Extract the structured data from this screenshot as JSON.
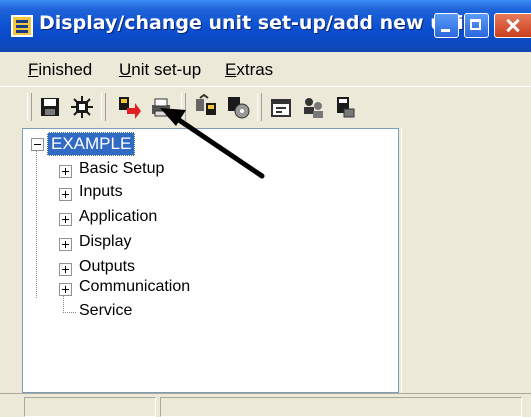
{
  "window": {
    "title": "Display/change unit set-up/add new unit"
  },
  "menu": {
    "items": [
      {
        "label": "Finished"
      },
      {
        "label": "Unit set-up"
      },
      {
        "label": "Extras"
      }
    ]
  },
  "toolbar": {
    "icons": [
      "save-icon",
      "settings-icon",
      "download-icon",
      "print-icon",
      "upload-icon",
      "disc-icon",
      "properties-icon",
      "users-icon",
      "device-icon"
    ]
  },
  "tree": {
    "root": "EXAMPLE",
    "nodes": [
      {
        "label": "Basic Setup"
      },
      {
        "label": "Inputs"
      },
      {
        "label": "Application"
      },
      {
        "label": "Display"
      },
      {
        "label": "Outputs"
      },
      {
        "label": "Communication"
      }
    ],
    "leaf": {
      "label": "Service"
    }
  },
  "colors": {
    "selection": "#316ac5",
    "titlebar": "#0a4fd0",
    "arrow": "#000000"
  }
}
